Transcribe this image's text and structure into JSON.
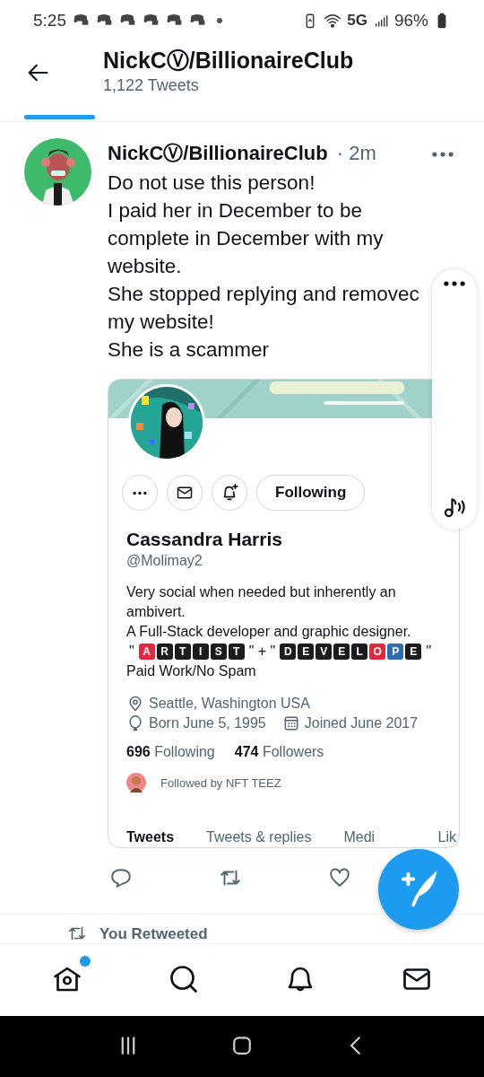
{
  "status_bar": {
    "time": "5:25",
    "network": "5G",
    "battery": "96%"
  },
  "header": {
    "title": "NickCⓋ/BillionaireClub",
    "subtitle": "1,122 Tweets"
  },
  "tweet": {
    "name": "NickCⓋ/BillionaireClub",
    "time": "· 2m",
    "lines": [
      "Do not use this person!",
      "I paid her in December to be",
      "complete in December with my",
      "website.",
      "She stopped replying and removec",
      "my website!",
      "She is a scammer"
    ],
    "embedded_profile": {
      "following_button": "Following",
      "name": "Cassandra Harris",
      "handle": "@Molimay2",
      "bio": [
        "Very social when needed but inherently an ambivert.",
        "A Full-Stack developer and graphic designer."
      ],
      "bio_tiles": [
        {
          "kind": "text",
          "text": "\""
        },
        {
          "kind": "tile",
          "text": "A",
          "color": "#e0293f"
        },
        {
          "kind": "tile",
          "text": "R",
          "color": "#1c1c1e"
        },
        {
          "kind": "tile",
          "text": "T",
          "color": "#1c1c1e"
        },
        {
          "kind": "tile",
          "text": "I",
          "color": "#1c1c1e"
        },
        {
          "kind": "tile",
          "text": "S",
          "color": "#1c1c1e"
        },
        {
          "kind": "tile",
          "text": "T",
          "color": "#1c1c1e"
        },
        {
          "kind": "text",
          "text": "\" + \""
        },
        {
          "kind": "tile",
          "text": "D",
          "color": "#1c1c1e"
        },
        {
          "kind": "tile",
          "text": "E",
          "color": "#1c1c1e"
        },
        {
          "kind": "tile",
          "text": "V",
          "color": "#1c1c1e"
        },
        {
          "kind": "tile",
          "text": "E",
          "color": "#1c1c1e"
        },
        {
          "kind": "tile",
          "text": "L",
          "color": "#1c1c1e"
        },
        {
          "kind": "tile",
          "text": "O",
          "color": "#e0293f"
        },
        {
          "kind": "tile",
          "text": "P",
          "color": "#2a6fb0"
        },
        {
          "kind": "tile",
          "text": "E",
          "color": "#1c1c1e"
        },
        {
          "kind": "text",
          "text": "''"
        }
      ],
      "bio_end": "Paid Work/No Spam",
      "location": "Seattle, Washington USA",
      "born": "Born June 5, 1995",
      "joined": "Joined June 2017",
      "following_count": "696",
      "following_label": "Following",
      "followers_count": "474",
      "followers_label": "Followers",
      "followed_by": "Followed by NFT TEEZ",
      "tabs": [
        {
          "label": "Tweets",
          "selected": true
        },
        {
          "label": "Tweets & replies",
          "selected": false
        },
        {
          "label": "Medi",
          "selected": false
        },
        {
          "label": "Lik",
          "selected": false
        }
      ]
    }
  },
  "retweet_notice": "You Retweeted"
}
